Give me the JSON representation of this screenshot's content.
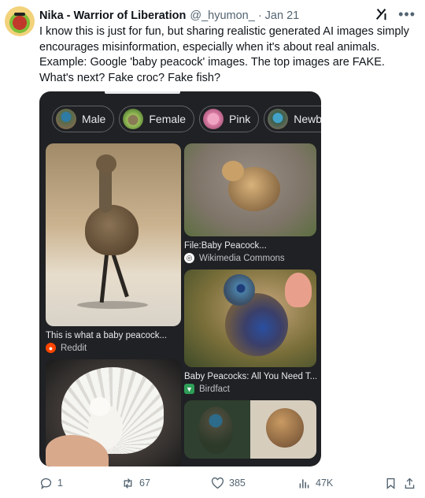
{
  "tweet": {
    "author_name": "Nika - Warrior of Liberation",
    "handle": "@_hyumon_",
    "separator": "·",
    "date": "Jan 21",
    "more_icon": "more-horizontal-icon",
    "grok_icon": "grok-icon",
    "text": "I know this is just for fun, but sharing realistic generated AI images simply encourages misinformation, especially when it's about real animals. Example: Google 'baby peacock' images. The top images are FAKE. What's next? Fake croc? Fake fish?"
  },
  "screenshot": {
    "chips": [
      {
        "label": "Male"
      },
      {
        "label": "Female"
      },
      {
        "label": "Pink"
      },
      {
        "label": "Newborn"
      }
    ],
    "results": [
      {
        "caption": "This is what a baby peacock...",
        "source": "Reddit",
        "source_icon": "reddit-icon"
      },
      {
        "caption": "File:Baby Peacock...",
        "source": "Wikimedia Commons",
        "source_icon": "wikimedia-icon"
      },
      {
        "caption": "Baby Peacocks: All You Need T...",
        "source": "Birdfact",
        "source_icon": "birdfact-icon"
      }
    ]
  },
  "actions": {
    "replies": "1",
    "reposts": "67",
    "likes": "385",
    "views": "47K"
  },
  "colors": {
    "text": "#0f1419",
    "muted": "#536471",
    "media_bg": "#202124"
  }
}
